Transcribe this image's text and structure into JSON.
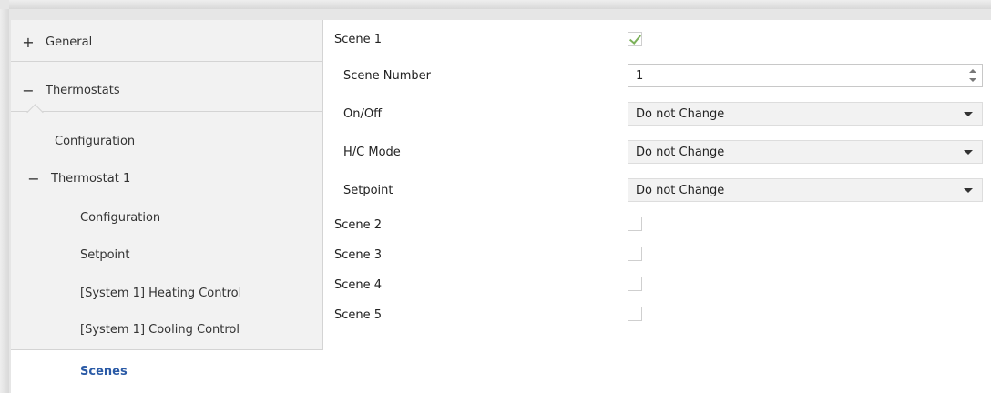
{
  "sidebar": {
    "items": [
      {
        "symbol": "+",
        "label": "General"
      },
      {
        "symbol": "−",
        "label": "Thermostats"
      },
      {
        "symbol": "",
        "label": "Configuration"
      },
      {
        "symbol": "−",
        "label": "Thermostat 1"
      },
      {
        "symbol": "",
        "label": "Configuration"
      },
      {
        "symbol": "",
        "label": "Setpoint"
      },
      {
        "symbol": "",
        "label": "[System 1] Heating Control"
      },
      {
        "symbol": "",
        "label": "[System 1] Cooling Control"
      },
      {
        "symbol": "",
        "label": "Scenes",
        "selected": true
      }
    ]
  },
  "main": {
    "scene1": {
      "label": "Scene 1",
      "checked": true
    },
    "scene_number": {
      "label": "Scene Number",
      "value": "1"
    },
    "on_off": {
      "label": "On/Off",
      "value": "Do not Change"
    },
    "hc_mode": {
      "label": "H/C Mode",
      "value": "Do not Change"
    },
    "setpoint": {
      "label": "Setpoint",
      "value": "Do not Change"
    },
    "scene2": {
      "label": "Scene 2",
      "checked": false
    },
    "scene3": {
      "label": "Scene 3",
      "checked": false
    },
    "scene4": {
      "label": "Scene 4",
      "checked": false
    },
    "scene5": {
      "label": "Scene 5",
      "checked": false
    }
  },
  "colors": {
    "selected_text": "#2a5aa6",
    "check_mark": "#7cb15a",
    "sidebar_bg": "#f2f2f2"
  }
}
